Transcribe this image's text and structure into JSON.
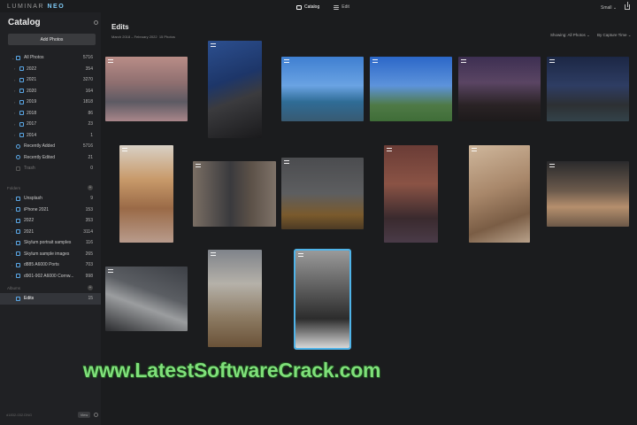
{
  "app": {
    "brand_prefix": "LUMINAR",
    "brand_suffix": "NEO",
    "tabs": [
      {
        "label": "Catalog",
        "active": true
      },
      {
        "label": "Edit",
        "active": false
      }
    ],
    "size_select": "Small",
    "accent": "#4fb3e8"
  },
  "sidebar": {
    "title": "Catalog",
    "add_photos_label": "Add Photos",
    "all_photos": {
      "label": "All Photos",
      "count": "5716"
    },
    "years": [
      {
        "label": "2022",
        "count": "354"
      },
      {
        "label": "2021",
        "count": "3270"
      },
      {
        "label": "2020",
        "count": "164"
      },
      {
        "label": "2019",
        "count": "1818"
      },
      {
        "label": "2018",
        "count": "86"
      },
      {
        "label": "2017",
        "count": "23"
      },
      {
        "label": "2014",
        "count": "1"
      }
    ],
    "smart": [
      {
        "label": "Recently Added",
        "count": "5716"
      },
      {
        "label": "Recently Edited",
        "count": "21"
      },
      {
        "label": "Trash",
        "count": "0"
      }
    ],
    "folders_header": "Folders",
    "folders": [
      {
        "label": "Unsplash",
        "count": "9"
      },
      {
        "label": "iPhone 2021",
        "count": "153"
      },
      {
        "label": "2022",
        "count": "353"
      },
      {
        "label": "2021",
        "count": "3114"
      },
      {
        "label": "Skylum portrait samples",
        "count": "116"
      },
      {
        "label": "Skylum sample images",
        "count": "265"
      },
      {
        "label": "d885 A6000 Ports",
        "count": "703"
      },
      {
        "label": "d901-902 A6000 Cornw...",
        "count": "998"
      }
    ],
    "albums_header": "Albums",
    "albums": [
      {
        "label": "Edits",
        "count": "15"
      }
    ],
    "footer_filename": "d1832-032.DNG",
    "footer_view": "View"
  },
  "main": {
    "title": "Edits",
    "date_range": "March 2018 – February 2022",
    "photo_count": "15 Photos",
    "showing_label": "Showing: All Photos ⌄",
    "sort_label": "By Capture Time ⌄"
  },
  "watermark": "www.LatestSoftwareCrack.com"
}
